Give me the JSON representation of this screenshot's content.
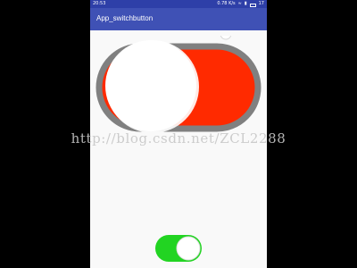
{
  "status_bar": {
    "time": "20:53",
    "right_text": "0.78 K/s",
    "battery": "17"
  },
  "app_bar": {
    "title": "App_switchbutton"
  },
  "big_switch": {
    "state": "on",
    "track_color": "#ff2a00",
    "border_color": "#808080",
    "thumb_color": "#ffffff"
  },
  "small_switch": {
    "state": "on",
    "track_color": "#22d422",
    "thumb_color": "#ffffff"
  },
  "watermark": {
    "text": "http://blog.csdn.net/ZCL2288"
  },
  "colors": {
    "primary": "#3f51b5",
    "status_bar": "#2e3fa8",
    "background": "#f9f9f9"
  }
}
